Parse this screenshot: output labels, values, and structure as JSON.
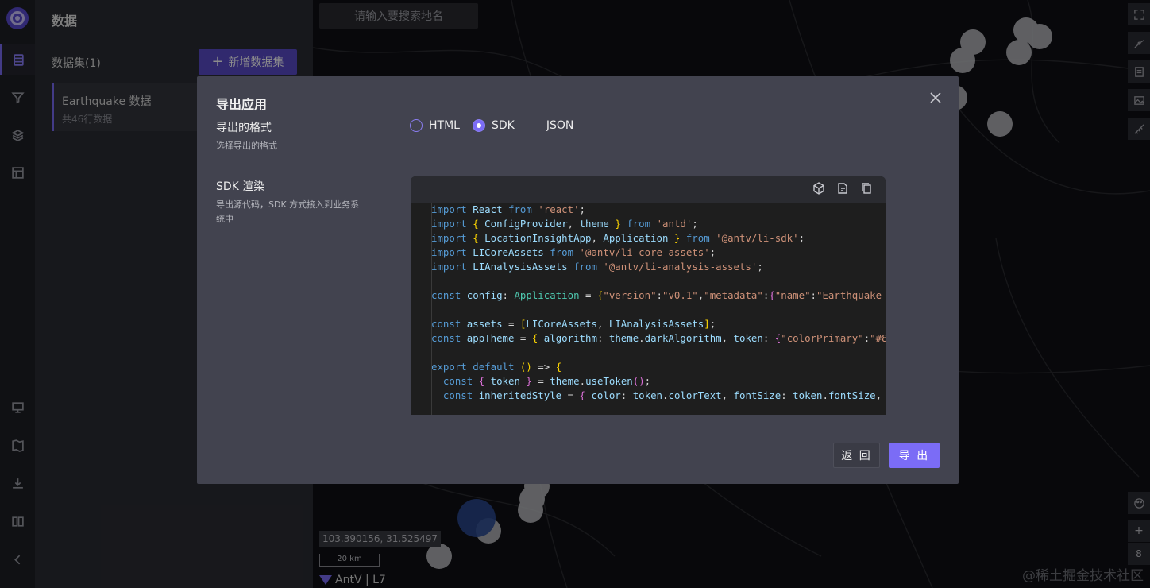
{
  "rail": {
    "items": [
      "database-icon",
      "filter-icon",
      "layers-icon",
      "layout-icon",
      "monitor-icon",
      "map-book-icon",
      "download-icon",
      "book-icon",
      "collapse-icon"
    ]
  },
  "panel": {
    "title": "数据",
    "datasets_label": "数据集(1)",
    "add_button": "新增数据集",
    "dataset": {
      "name": "Earthquake 数据",
      "count": "共46行数据"
    }
  },
  "map": {
    "search_placeholder": "请输入要搜索地名",
    "coords": "103.390156, 31.525497",
    "scale": "20 km",
    "brand": "AntV | L7",
    "zoom_level": "8",
    "watermark": "@稀土掘金技术社区"
  },
  "modal": {
    "title": "导出应用",
    "format_label": "导出的格式",
    "format_hint": "选择导出的格式",
    "formats": [
      {
        "label": "HTML",
        "checked": false
      },
      {
        "label": "SDK",
        "checked": true
      },
      {
        "label": "JSON",
        "checked": false
      }
    ],
    "sdk_label": "SDK 渲染",
    "sdk_hint": "导出源代码，SDK 方式接入到业务系统中",
    "back_button": "返 回",
    "export_button": "导 出"
  },
  "colors": {
    "accent": "#7b6cf6",
    "modal_bg": "#42434f",
    "panel_bg": "#2b2c33"
  }
}
